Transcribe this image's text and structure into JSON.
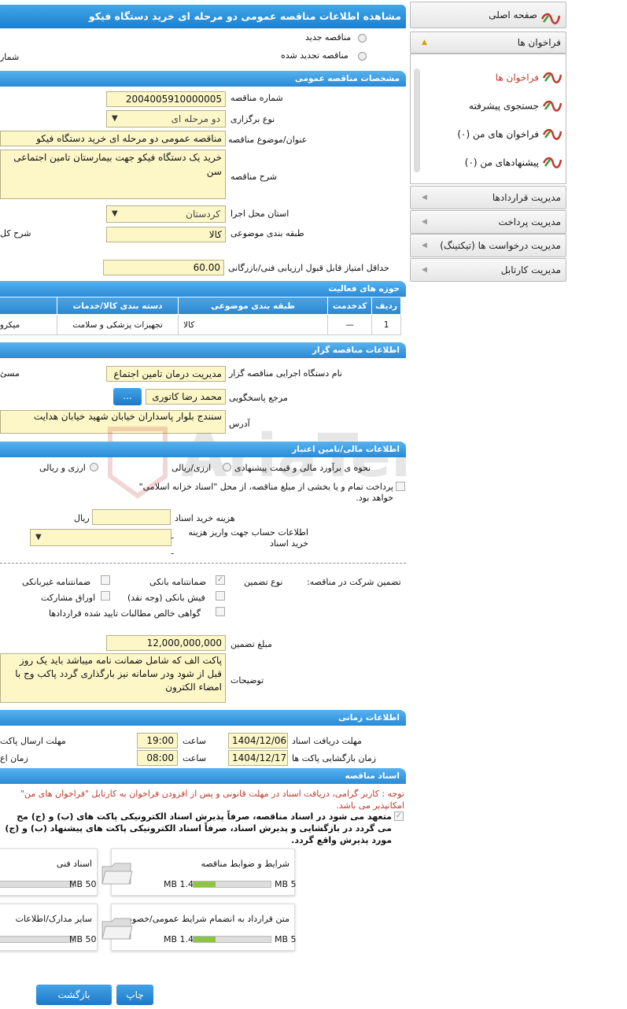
{
  "title": "مشاهده اطلاعات مناقصه عمومی دو مرحله ای خرید دستگاه فیکو",
  "radios": {
    "new": "مناقصه جدید",
    "renewed": "مناقصه تجدید شده",
    "left_cut": "شمار"
  },
  "sections": {
    "general": "مشخصات مناقصه عمومی",
    "activity": "حوزه های فعالیت",
    "issuer": "اطلاعات مناقصه گزار",
    "finance": "اطلاعات مالی/تامین اعتبار",
    "time": "اطلاعات زمانی",
    "docs": "اسناد مناقصه"
  },
  "general": {
    "number_label": "شماره مناقصه",
    "number": "2004005910000005",
    "type_label": "نوع برگزاری",
    "type": "دو مرحله ای",
    "subject_label": "عنوان/موضوع مناقصه",
    "subject": "مناقصه عمومی دو مرحله ای خرید دستگاه فیکو",
    "desc_label": "شرح مناقصه",
    "desc": "خرید یک دستگاه فیکو جهت بیمارستان تامین اجتماعی سن",
    "province_label": "استان محل اجرا",
    "province": "کردستان",
    "category_label": "طبقه بندی موضوعی",
    "category": "کالا",
    "left_cut": "شرح کل",
    "score_label": "حداقل امتیاز قابل قبول ارزیابی فنی/بازرگانی",
    "score": "60.00"
  },
  "activity_table": {
    "headers": [
      "ردیف",
      "کدخدمت",
      "طبقه بندی موضوعی",
      "دسته بندی کالا/خدمات"
    ],
    "rows": [
      [
        "1",
        "—",
        "کالا",
        "تجهیزات پزشکی و سلامت",
        "میکروس"
      ]
    ]
  },
  "issuer": {
    "org_label": "نام دستگاه اجرایی مناقصه گزار",
    "org": "مدیریت درمان تامین اجتماع",
    "left_cut": "مسئ",
    "ref_label": "مرجع پاسخگویی",
    "ref": "محمد رضا کاتوری",
    "ref_btn": "...",
    "addr_label": "آدرس",
    "addr": "سنندج بلوار پاسداران خیابان شهید خیابان هدایت"
  },
  "finance": {
    "method_label": "نحوه ی برآورد مالی و قیمت پیشنهادی",
    "opt1": "ارزی/ریالی",
    "opt2": "ارزی و ریالی",
    "treasury": "پرداخت تمام و یا بخشی از مبلغ مناقصه، از محل \"اسناد خزانه اسلامی\" خواهد بود.",
    "doc_cost_label": "هزینه خرید اسناد",
    "doc_cost_unit": "ریال",
    "account_label": "اطلاعات حساب جهت واریز هزینه خرید اسناد",
    "account": "--"
  },
  "guarantee": {
    "label": "تضمین شرکت در مناقصه:",
    "type_label": "نوع تضمین",
    "opts": [
      "ضمانتنامه بانکی",
      "ضمانتنامه غیربانکی",
      "فیش بانکی (وجه نقد)",
      "اوراق مشارکت",
      "گواهی خالص مطالبات تایید شده قراردادها"
    ],
    "amount_label": "مبلغ تضمین",
    "amount": "12,000,000,000",
    "notes_label": "توضیحات",
    "notes": "پاکت الف که شامل ضمانت نامه میباشد باید یک روز قبل از شود ودر سامانه نیز بارگذاری گردد پاکب وج با امضاء الکترون"
  },
  "time": {
    "receive_label": "مهلت دریافت اسناد",
    "receive_date": "1404/12/06",
    "time_label": "ساعت",
    "receive_time": "19:00",
    "open_label": "زمان بازگشایی پاکت ها",
    "open_date": "1404/12/17",
    "open_time": "08:00",
    "left1": "مهلت ارسال پاکت",
    "left2": "زمان اع"
  },
  "docs": {
    "notice": "توجه : کاربر گرامی، دریافت اسناد در مهلت قانونی و پس از افزودن فراخوان به کارتابل \"فراخوان های من\" امکانپذیر می باشد.",
    "commit": "متعهد می شود در اسناد مناقصه، صرفاً پذیرش اسناد الکترونیکی پاکت های (ب) و (ج) مح می گردد در بازگشایی و پذیرش اسناد، صرفاً اسناد الکترونیکی پاکت های پیشنهاد (ب) و (ج) مورد پذیرش واقع گردد.",
    "items": [
      {
        "name": "شرایط و ضوابط مناقصه",
        "used": "1.47 MB",
        "max": "5 MB",
        "fill": 0.29
      },
      {
        "name": "اسناد فنی",
        "used": "",
        "max": "50 MB",
        "fill": 0
      },
      {
        "name": "متن قرارداد به انضمام شرایط عمومی/خصوصی",
        "used": "1.47 MB",
        "max": "5 MB",
        "fill": 0.29
      },
      {
        "name": "سایر مدارک/اطلاعات",
        "used": "",
        "max": "50 MB",
        "fill": 0
      }
    ]
  },
  "buttons": {
    "print": "چاپ",
    "back": "بازگشت"
  },
  "sidebar": {
    "home": "صفحه اصلی",
    "calls": "فراخوان ها",
    "sub": [
      "فراخوان ها",
      "جستجوی پیشرفته",
      "فراخوان های من (۰)",
      "پیشنهادهای من (۰)"
    ],
    "menus": [
      "مدیریت قراردادها",
      "مدیریت پرداخت",
      "مدیریت درخواست ها (تیکتینگ)",
      "مدیریت کارتابل"
    ]
  },
  "watermark": "AriaTender.neT",
  "colors": {
    "header": "#2a8ad6",
    "field": "#fdf7c8",
    "accent_red": "#c0392b"
  }
}
